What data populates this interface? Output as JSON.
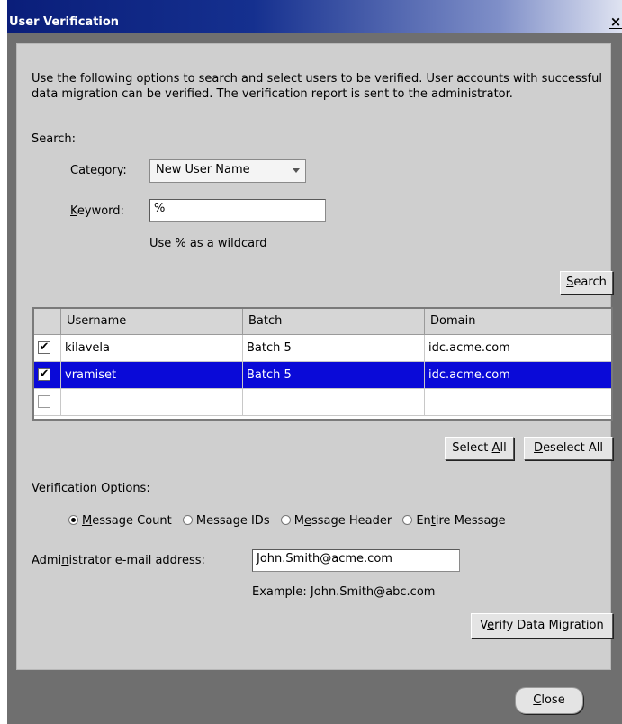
{
  "window": {
    "title": "User Verification",
    "close_icon": "close-x-icon"
  },
  "intro": {
    "description": "Use the following options to search and select users to be verified. User accounts with successful data migration can be verified. The verification report is sent to the administrator."
  },
  "search": {
    "section_label": "Search:",
    "category_label": "Category:",
    "category_value": "New User Name",
    "keyword_label_prefix": "",
    "keyword_label_u": "K",
    "keyword_label_rest": "eyword:",
    "keyword_value": "%",
    "wildcard_hint": "Use % as a wildcard",
    "search_button_u": "S",
    "search_button_rest": "earch"
  },
  "results": {
    "columns": [
      "Username",
      "Batch",
      "Domain"
    ],
    "rows": [
      {
        "checked": "✔",
        "username": "kilavela",
        "batch": "Batch 5",
        "domain": "idc.acme.com",
        "selected": false
      },
      {
        "checked": "✔",
        "username": "vramiset",
        "batch": "Batch 5",
        "domain": "idc.acme.com",
        "selected": true
      },
      {
        "checked": "",
        "username": "",
        "batch": "",
        "domain": "",
        "selected": false
      }
    ],
    "select_all_prefix": "Select ",
    "select_all_u": "A",
    "select_all_rest": "ll",
    "deselect_all_u": "D",
    "deselect_all_rest": "eselect All"
  },
  "verification": {
    "label": "Verification Options:",
    "options": [
      {
        "u": "M",
        "rest": "essage Count",
        "prefix": "",
        "selected": true
      },
      {
        "u": "",
        "rest": "",
        "prefix": "Message IDs",
        "selected": false
      },
      {
        "u": "e",
        "rest": "ssage Header",
        "prefix": "M",
        "selected": false
      },
      {
        "u": "t",
        "rest": "ire Message",
        "prefix": "En",
        "selected": false
      }
    ]
  },
  "admin": {
    "label_prefix": "Admi",
    "label_u": "n",
    "label_rest": "istrator e-mail address:",
    "email_value": "John.Smith@acme.com",
    "example": "Example: John.Smith@abc.com"
  },
  "verify_button": {
    "prefix": "V",
    "u": "e",
    "rest": "rify Data Migration"
  },
  "close_button": {
    "u": "C",
    "rest": "lose"
  }
}
